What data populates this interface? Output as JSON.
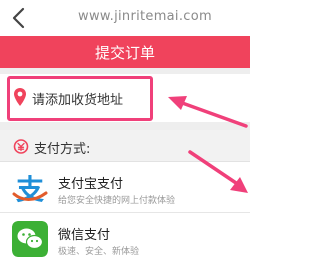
{
  "browser": {
    "url": "www.jinritemai.com"
  },
  "header": {
    "title": "提交订单"
  },
  "address": {
    "placeholder_label": "请添加收货地址"
  },
  "payment": {
    "section_label": "支付方式:",
    "methods": [
      {
        "name": "支付宝支付",
        "desc": "给您安全快捷的网上付款体验",
        "icon": "alipay-logo-icon",
        "color": "#1f8fd8"
      },
      {
        "name": "微信支付",
        "desc": "极速、安全、新体验",
        "icon": "wechat-logo-icon",
        "color": "#3cb035"
      }
    ]
  },
  "colors": {
    "accent": "#f0435c",
    "annotation": "#f0407a",
    "alipay": "#1f8fd8",
    "wechat": "#3cb035"
  }
}
